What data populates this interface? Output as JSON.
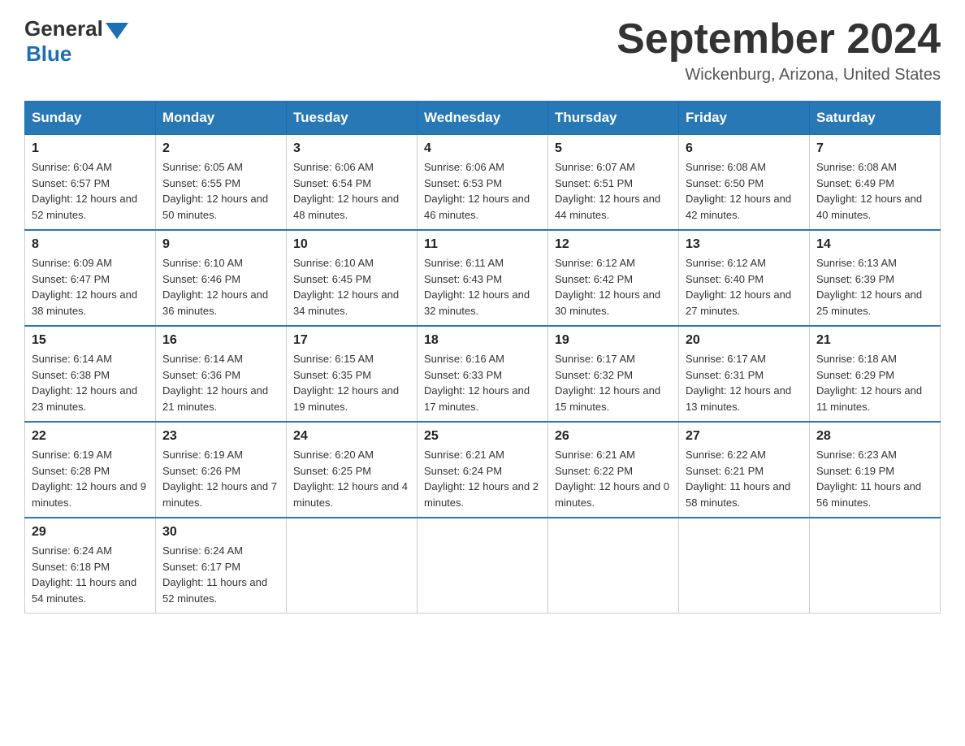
{
  "header": {
    "logo_general": "General",
    "logo_blue": "Blue",
    "month_title": "September 2024",
    "location": "Wickenburg, Arizona, United States"
  },
  "days_of_week": [
    "Sunday",
    "Monday",
    "Tuesday",
    "Wednesday",
    "Thursday",
    "Friday",
    "Saturday"
  ],
  "weeks": [
    [
      {
        "day": "1",
        "sunrise": "Sunrise: 6:04 AM",
        "sunset": "Sunset: 6:57 PM",
        "daylight": "Daylight: 12 hours and 52 minutes."
      },
      {
        "day": "2",
        "sunrise": "Sunrise: 6:05 AM",
        "sunset": "Sunset: 6:55 PM",
        "daylight": "Daylight: 12 hours and 50 minutes."
      },
      {
        "day": "3",
        "sunrise": "Sunrise: 6:06 AM",
        "sunset": "Sunset: 6:54 PM",
        "daylight": "Daylight: 12 hours and 48 minutes."
      },
      {
        "day": "4",
        "sunrise": "Sunrise: 6:06 AM",
        "sunset": "Sunset: 6:53 PM",
        "daylight": "Daylight: 12 hours and 46 minutes."
      },
      {
        "day": "5",
        "sunrise": "Sunrise: 6:07 AM",
        "sunset": "Sunset: 6:51 PM",
        "daylight": "Daylight: 12 hours and 44 minutes."
      },
      {
        "day": "6",
        "sunrise": "Sunrise: 6:08 AM",
        "sunset": "Sunset: 6:50 PM",
        "daylight": "Daylight: 12 hours and 42 minutes."
      },
      {
        "day": "7",
        "sunrise": "Sunrise: 6:08 AM",
        "sunset": "Sunset: 6:49 PM",
        "daylight": "Daylight: 12 hours and 40 minutes."
      }
    ],
    [
      {
        "day": "8",
        "sunrise": "Sunrise: 6:09 AM",
        "sunset": "Sunset: 6:47 PM",
        "daylight": "Daylight: 12 hours and 38 minutes."
      },
      {
        "day": "9",
        "sunrise": "Sunrise: 6:10 AM",
        "sunset": "Sunset: 6:46 PM",
        "daylight": "Daylight: 12 hours and 36 minutes."
      },
      {
        "day": "10",
        "sunrise": "Sunrise: 6:10 AM",
        "sunset": "Sunset: 6:45 PM",
        "daylight": "Daylight: 12 hours and 34 minutes."
      },
      {
        "day": "11",
        "sunrise": "Sunrise: 6:11 AM",
        "sunset": "Sunset: 6:43 PM",
        "daylight": "Daylight: 12 hours and 32 minutes."
      },
      {
        "day": "12",
        "sunrise": "Sunrise: 6:12 AM",
        "sunset": "Sunset: 6:42 PM",
        "daylight": "Daylight: 12 hours and 30 minutes."
      },
      {
        "day": "13",
        "sunrise": "Sunrise: 6:12 AM",
        "sunset": "Sunset: 6:40 PM",
        "daylight": "Daylight: 12 hours and 27 minutes."
      },
      {
        "day": "14",
        "sunrise": "Sunrise: 6:13 AM",
        "sunset": "Sunset: 6:39 PM",
        "daylight": "Daylight: 12 hours and 25 minutes."
      }
    ],
    [
      {
        "day": "15",
        "sunrise": "Sunrise: 6:14 AM",
        "sunset": "Sunset: 6:38 PM",
        "daylight": "Daylight: 12 hours and 23 minutes."
      },
      {
        "day": "16",
        "sunrise": "Sunrise: 6:14 AM",
        "sunset": "Sunset: 6:36 PM",
        "daylight": "Daylight: 12 hours and 21 minutes."
      },
      {
        "day": "17",
        "sunrise": "Sunrise: 6:15 AM",
        "sunset": "Sunset: 6:35 PM",
        "daylight": "Daylight: 12 hours and 19 minutes."
      },
      {
        "day": "18",
        "sunrise": "Sunrise: 6:16 AM",
        "sunset": "Sunset: 6:33 PM",
        "daylight": "Daylight: 12 hours and 17 minutes."
      },
      {
        "day": "19",
        "sunrise": "Sunrise: 6:17 AM",
        "sunset": "Sunset: 6:32 PM",
        "daylight": "Daylight: 12 hours and 15 minutes."
      },
      {
        "day": "20",
        "sunrise": "Sunrise: 6:17 AM",
        "sunset": "Sunset: 6:31 PM",
        "daylight": "Daylight: 12 hours and 13 minutes."
      },
      {
        "day": "21",
        "sunrise": "Sunrise: 6:18 AM",
        "sunset": "Sunset: 6:29 PM",
        "daylight": "Daylight: 12 hours and 11 minutes."
      }
    ],
    [
      {
        "day": "22",
        "sunrise": "Sunrise: 6:19 AM",
        "sunset": "Sunset: 6:28 PM",
        "daylight": "Daylight: 12 hours and 9 minutes."
      },
      {
        "day": "23",
        "sunrise": "Sunrise: 6:19 AM",
        "sunset": "Sunset: 6:26 PM",
        "daylight": "Daylight: 12 hours and 7 minutes."
      },
      {
        "day": "24",
        "sunrise": "Sunrise: 6:20 AM",
        "sunset": "Sunset: 6:25 PM",
        "daylight": "Daylight: 12 hours and 4 minutes."
      },
      {
        "day": "25",
        "sunrise": "Sunrise: 6:21 AM",
        "sunset": "Sunset: 6:24 PM",
        "daylight": "Daylight: 12 hours and 2 minutes."
      },
      {
        "day": "26",
        "sunrise": "Sunrise: 6:21 AM",
        "sunset": "Sunset: 6:22 PM",
        "daylight": "Daylight: 12 hours and 0 minutes."
      },
      {
        "day": "27",
        "sunrise": "Sunrise: 6:22 AM",
        "sunset": "Sunset: 6:21 PM",
        "daylight": "Daylight: 11 hours and 58 minutes."
      },
      {
        "day": "28",
        "sunrise": "Sunrise: 6:23 AM",
        "sunset": "Sunset: 6:19 PM",
        "daylight": "Daylight: 11 hours and 56 minutes."
      }
    ],
    [
      {
        "day": "29",
        "sunrise": "Sunrise: 6:24 AM",
        "sunset": "Sunset: 6:18 PM",
        "daylight": "Daylight: 11 hours and 54 minutes."
      },
      {
        "day": "30",
        "sunrise": "Sunrise: 6:24 AM",
        "sunset": "Sunset: 6:17 PM",
        "daylight": "Daylight: 11 hours and 52 minutes."
      },
      null,
      null,
      null,
      null,
      null
    ]
  ]
}
